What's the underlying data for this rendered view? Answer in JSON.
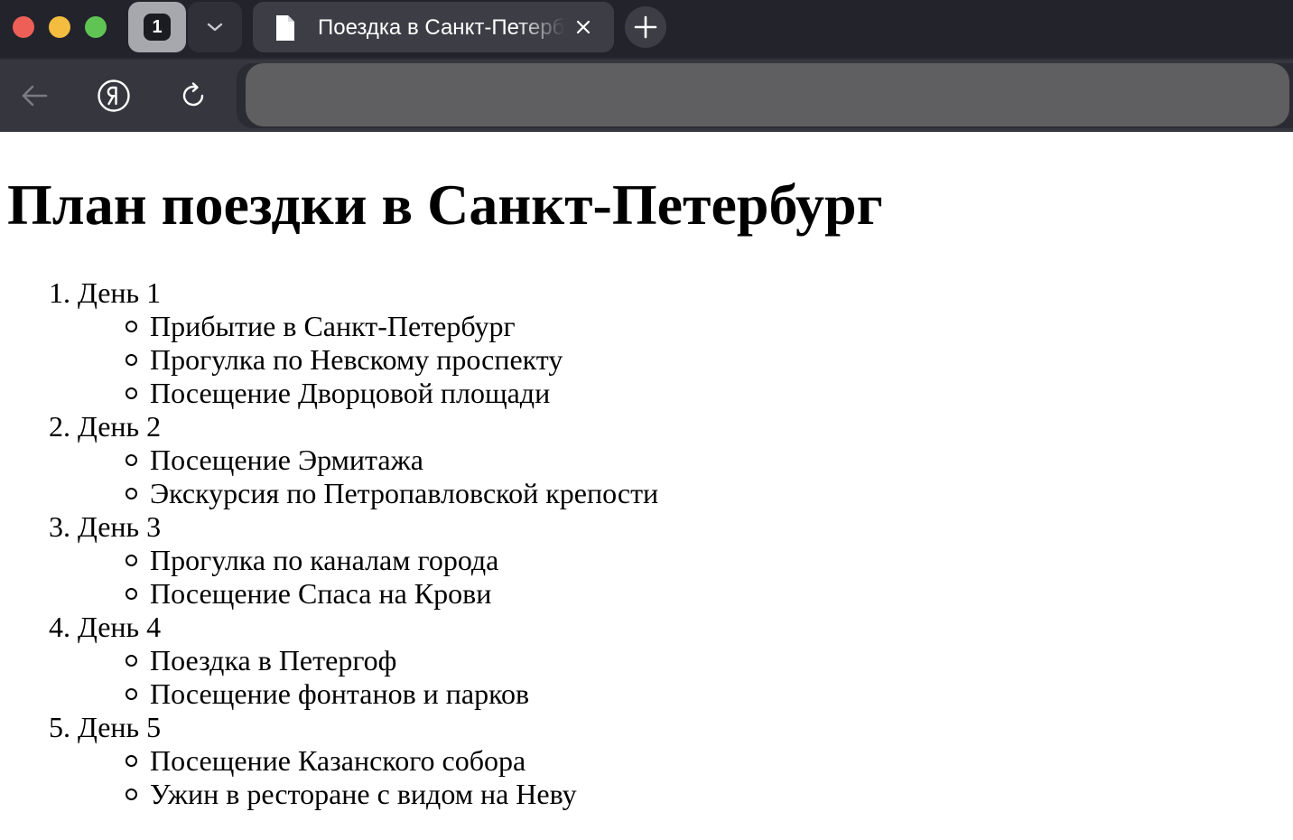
{
  "browser": {
    "tab_count": "1",
    "tab_title": "Поездка в Санкт-Петербург",
    "address": ""
  },
  "page": {
    "title": "План поездки в Санкт-Петербург",
    "days": [
      {
        "number": "1.",
        "label": "День 1",
        "items": [
          "Прибытие в Санкт-Петербург",
          "Прогулка по Невскому проспекту",
          "Посещение Дворцовой площади"
        ]
      },
      {
        "number": "2.",
        "label": "День 2",
        "items": [
          "Посещение Эрмитажа",
          "Экскурсия по Петропавловской крепости"
        ]
      },
      {
        "number": "3.",
        "label": "День 3",
        "items": [
          "Прогулка по каналам города",
          "Посещение Спаса на Крови"
        ]
      },
      {
        "number": "4.",
        "label": "День 4",
        "items": [
          "Поездка в Петергоф",
          "Посещение фонтанов и парков"
        ]
      },
      {
        "number": "5.",
        "label": "День 5",
        "items": [
          "Посещение Казанского собора",
          "Ужин в ресторане с видом на Неву"
        ]
      }
    ]
  },
  "colors": {
    "close": "#ee5f57",
    "minimize": "#f4bd3f",
    "maximize": "#5fc453",
    "chrome_dark": "#22232b",
    "toolbar": "#36373e",
    "addressbar": "#5f5f61"
  }
}
